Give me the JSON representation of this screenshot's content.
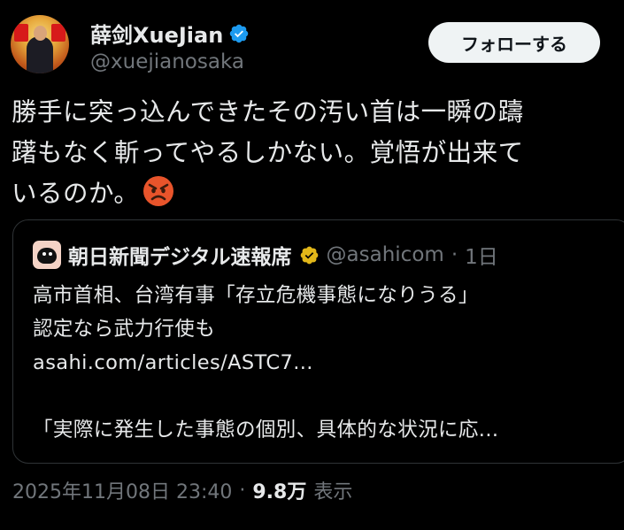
{
  "author": {
    "display_name": "薛剑XueJian",
    "handle": "@xuejianosaka",
    "verified_color": "#1d9bf0"
  },
  "follow_button": {
    "label": "フォローする"
  },
  "tweet": {
    "line1": "勝手に突っ込んできたその汚い首は一瞬の躊",
    "line2": "躇もなく斬ってやるしかない。覚悟が出来て",
    "line3": "いるのか。",
    "emoji": "angry-face-icon"
  },
  "quote": {
    "name": "朝日新聞デジタル速報席",
    "handle": "@asahicom",
    "separator": "·",
    "time": "1日",
    "badge_color": "#e2b719",
    "body_line1": "高市首相、台湾有事「存立危機事態になりうる」",
    "body_line2": "認定なら武力行使も",
    "link": "asahi.com/articles/ASTC7...",
    "body_line4": "「実際に発生した事態の個別、具体的な状況に応..."
  },
  "meta": {
    "date": "2025年11月08日 23:40",
    "separator": "·",
    "views": "9.8万",
    "views_label": "表示"
  }
}
